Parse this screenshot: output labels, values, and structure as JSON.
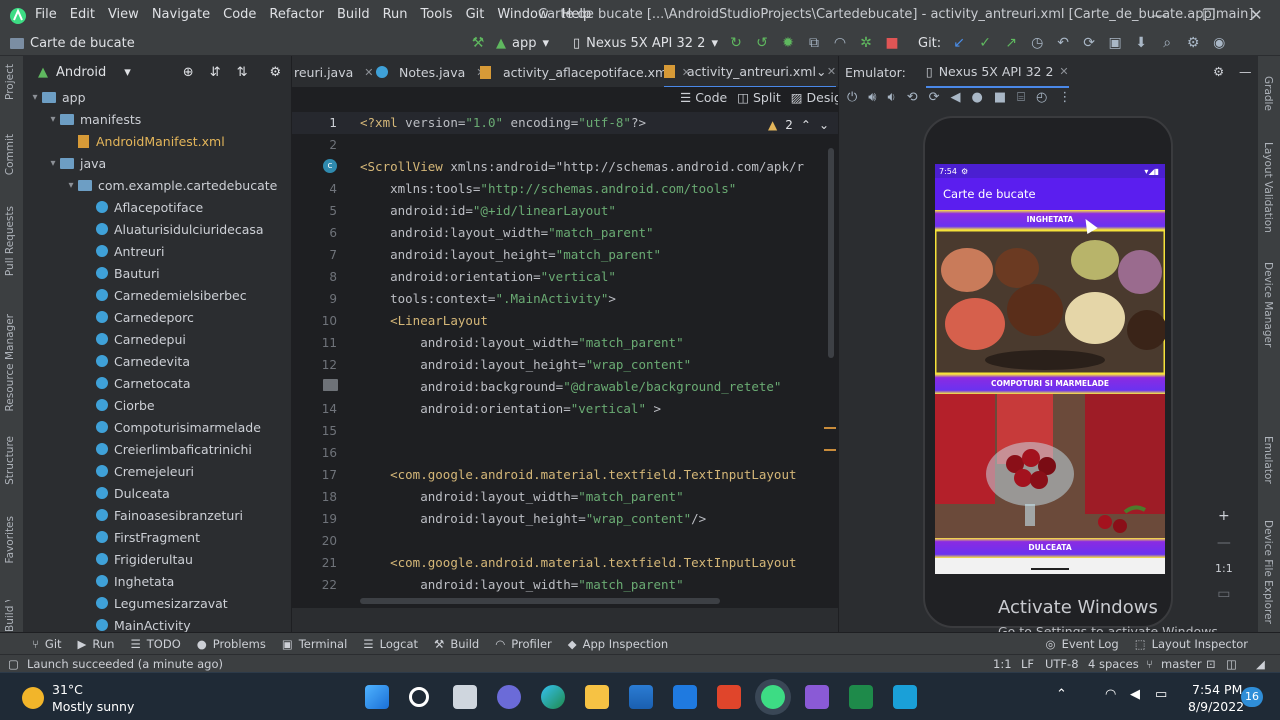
{
  "menu": [
    "File",
    "Edit",
    "View",
    "Navigate",
    "Code",
    "Refactor",
    "Build",
    "Run",
    "Tools",
    "Git",
    "Window",
    "Help"
  ],
  "window_title": "Carte de bucate [...\\AndroidStudioProjects\\Cartedebucate] - activity_antreuri.xml [Carte_de_bucate.app.main]",
  "toolbar": {
    "project": "Carte de bucate",
    "run_config": "app",
    "device": "Nexus 5X API 32 2",
    "git_label": "Git:"
  },
  "left_tools": [
    "Project",
    "Commit",
    "Pull Requests",
    "Resource Manager",
    "Structure",
    "Favorites",
    "Build Variants"
  ],
  "right_tools": [
    "Gradle",
    "Layout Validation",
    "Device Manager",
    "Emulator",
    "Device File Explorer"
  ],
  "project_panel": {
    "view": "Android",
    "tree": [
      {
        "label": "app",
        "type": "folder",
        "depth": 0
      },
      {
        "label": "manifests",
        "type": "folder",
        "depth": 1
      },
      {
        "label": "AndroidManifest.xml",
        "type": "xml",
        "depth": 2
      },
      {
        "label": "java",
        "type": "folder",
        "depth": 1
      },
      {
        "label": "com.example.cartedebucate",
        "type": "package",
        "depth": 2
      },
      {
        "label": "Aflacepotiface",
        "type": "class",
        "depth": 3
      },
      {
        "label": "Aluaturisidulciuridecasa",
        "type": "class",
        "depth": 3
      },
      {
        "label": "Antreuri",
        "type": "class",
        "depth": 3
      },
      {
        "label": "Bauturi",
        "type": "class",
        "depth": 3
      },
      {
        "label": "Carnedemielsiberbec",
        "type": "class",
        "depth": 3
      },
      {
        "label": "Carnedeporc",
        "type": "class",
        "depth": 3
      },
      {
        "label": "Carnedepui",
        "type": "class",
        "depth": 3
      },
      {
        "label": "Carnedevita",
        "type": "class",
        "depth": 3
      },
      {
        "label": "Carnetocata",
        "type": "class",
        "depth": 3
      },
      {
        "label": "Ciorbe",
        "type": "class",
        "depth": 3
      },
      {
        "label": "Compoturisimarmelade",
        "type": "class",
        "depth": 3
      },
      {
        "label": "Creierlimbaficatrinichi",
        "type": "class",
        "depth": 3
      },
      {
        "label": "Cremejeleuri",
        "type": "class",
        "depth": 3
      },
      {
        "label": "Dulceata",
        "type": "class",
        "depth": 3
      },
      {
        "label": "Fainoasesibranzeturi",
        "type": "class",
        "depth": 3
      },
      {
        "label": "FirstFragment",
        "type": "class",
        "depth": 3
      },
      {
        "label": "Frigiderultau",
        "type": "class",
        "depth": 3
      },
      {
        "label": "Inghetata",
        "type": "class",
        "depth": 3
      },
      {
        "label": "Legumesizarzavat",
        "type": "class",
        "depth": 3
      },
      {
        "label": "MainActivity",
        "type": "class",
        "depth": 3
      }
    ]
  },
  "tabs": [
    "reuri.java",
    "Notes.java",
    "activity_aflacepotiface.xml",
    "activity_antreuri.xml"
  ],
  "editor": {
    "view_modes": [
      "Code",
      "Split",
      "Design"
    ],
    "warnings": "2",
    "line_numbers": [
      "1",
      "2",
      "3",
      "4",
      "5",
      "6",
      "7",
      "8",
      "9",
      "10",
      "11",
      "12",
      "13",
      "14",
      "15",
      "16",
      "17",
      "18",
      "19",
      "20",
      "21",
      "22"
    ],
    "lines": [
      "<?xml version=\"1.0\" encoding=\"utf-8\"?>",
      "",
      "<ScrollView xmlns:android=\"http://schemas.android.com/apk/r",
      "    xmlns:tools=\"http://schemas.android.com/tools\"",
      "    android:id=\"@+id/linearLayout\"",
      "    android:layout_width=\"match_parent\"",
      "    android:layout_height=\"match_parent\"",
      "    android:orientation=\"vertical\"",
      "    tools:context=\".MainActivity\">",
      "    <LinearLayout",
      "        android:layout_width=\"match_parent\"",
      "        android:layout_height=\"wrap_content\"",
      "        android:background=\"@drawable/background_retete\"",
      "        android:orientation=\"vertical\" >",
      "",
      "",
      "    <com.google.android.material.textfield.TextInputLayout",
      "        android:layout_width=\"match_parent\"",
      "        android:layout_height=\"wrap_content\"/>",
      "",
      "    <com.google.android.material.textfield.TextInputLayout",
      "        android:layout_width=\"match_parent\""
    ]
  },
  "emulator": {
    "label": "Emulator:",
    "device_tab": "Nexus 5X API 32 2",
    "phone": {
      "time": "7:54",
      "app_title": "Carte de bucate",
      "sections": [
        "INGHETATA",
        "COMPOTURI SI MARMELADE",
        "DULCEATA"
      ]
    },
    "zoom_label": "1:1"
  },
  "watermark": {
    "title": "Activate Windows",
    "subtitle": "Go to Settings to activate Windows."
  },
  "bottom_tools": [
    "Git",
    "Run",
    "TODO",
    "Problems",
    "Terminal",
    "Logcat",
    "Build",
    "Profiler",
    "App Inspection"
  ],
  "bottom_right": [
    "Event Log",
    "Layout Inspector"
  ],
  "status": {
    "message": "Launch succeeded (a minute ago)",
    "position": "1:1",
    "line_sep": "LF",
    "encoding": "UTF-8",
    "indent": "4 spaces",
    "branch": "master"
  },
  "taskbar": {
    "temp": "31°C",
    "weather": "Mostly sunny",
    "time": "7:54 PM",
    "date": "8/9/2022",
    "notif": "16"
  }
}
